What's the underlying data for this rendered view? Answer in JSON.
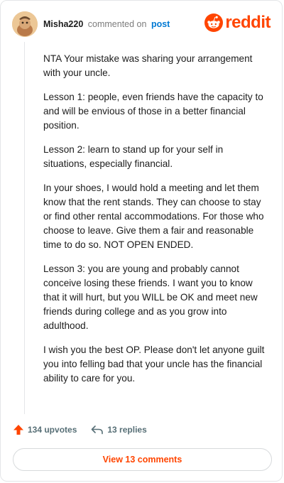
{
  "header": {
    "username": "Misha220",
    "commented_on": "commented on",
    "post_link": "post",
    "logo_text": "reddit"
  },
  "comment": {
    "paragraphs": [
      "NTA Your mistake was sharing your arrangement with your uncle.",
      "Lesson 1: people, even friends have the capacity to and will be envious of those in a better financial position.",
      "Lesson 2: learn to stand up for your self in situations, especially financial.",
      "In your shoes, I would hold a meeting and let them know that the rent stands. They can choose to stay or find other rental accommodations. For those who choose to leave. Give them a fair and reasonable time to do so. NOT OPEN ENDED.",
      "Lesson 3: you are young and probably cannot conceive losing these friends. I want you to know that it will hurt, but you WILL be OK and meet new friends during college and as you grow into adulthood.",
      "I wish you the best OP. Please don't let anyone guilt you into felling bad that your uncle has the financial ability to care for you."
    ]
  },
  "actions": {
    "upvotes": "134 upvotes",
    "replies": "13 replies",
    "view_comments": "View 13 comments"
  },
  "colors": {
    "brand": "#ff4500",
    "link": "#0079d3",
    "muted": "#576f76"
  },
  "icons": {
    "logo": "reddit-snoo-icon",
    "upvote": "upvote-arrow-icon",
    "reply": "reply-arrow-icon"
  }
}
